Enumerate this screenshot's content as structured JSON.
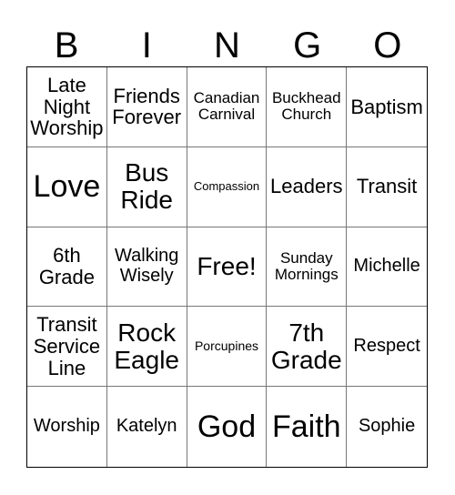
{
  "header": {
    "letters": [
      "B",
      "I",
      "N",
      "G",
      "O"
    ]
  },
  "cells": [
    {
      "text": "Late Night Worship",
      "size": "s-m"
    },
    {
      "text": "Friends Forever",
      "size": "s-m"
    },
    {
      "text": "Canadian Carnival",
      "size": "s-s"
    },
    {
      "text": "Buckhead Church",
      "size": "s-s"
    },
    {
      "text": "Baptism",
      "size": "s-m"
    },
    {
      "text": "Love",
      "size": "s-xl"
    },
    {
      "text": "Bus Ride",
      "size": "s-l"
    },
    {
      "text": "Compassion",
      "size": "s-xxs"
    },
    {
      "text": "Leaders",
      "size": "s-m"
    },
    {
      "text": "Transit",
      "size": "s-m"
    },
    {
      "text": "6th Grade",
      "size": "s-m"
    },
    {
      "text": "Walking Wisely",
      "size": "s-ms"
    },
    {
      "text": "Free!",
      "size": "s-l"
    },
    {
      "text": "Sunday Mornings",
      "size": "s-s"
    },
    {
      "text": "Michelle",
      "size": "s-ms"
    },
    {
      "text": "Transit Service Line",
      "size": "s-m"
    },
    {
      "text": "Rock Eagle",
      "size": "s-l"
    },
    {
      "text": "Porcupines",
      "size": "s-xs"
    },
    {
      "text": "7th Grade",
      "size": "s-l"
    },
    {
      "text": "Respect",
      "size": "s-ms"
    },
    {
      "text": "Worship",
      "size": "s-ms"
    },
    {
      "text": "Katelyn",
      "size": "s-ms"
    },
    {
      "text": "God",
      "size": "s-xl"
    },
    {
      "text": "Faith",
      "size": "s-xl"
    },
    {
      "text": "Sophie",
      "size": "s-ms"
    }
  ]
}
